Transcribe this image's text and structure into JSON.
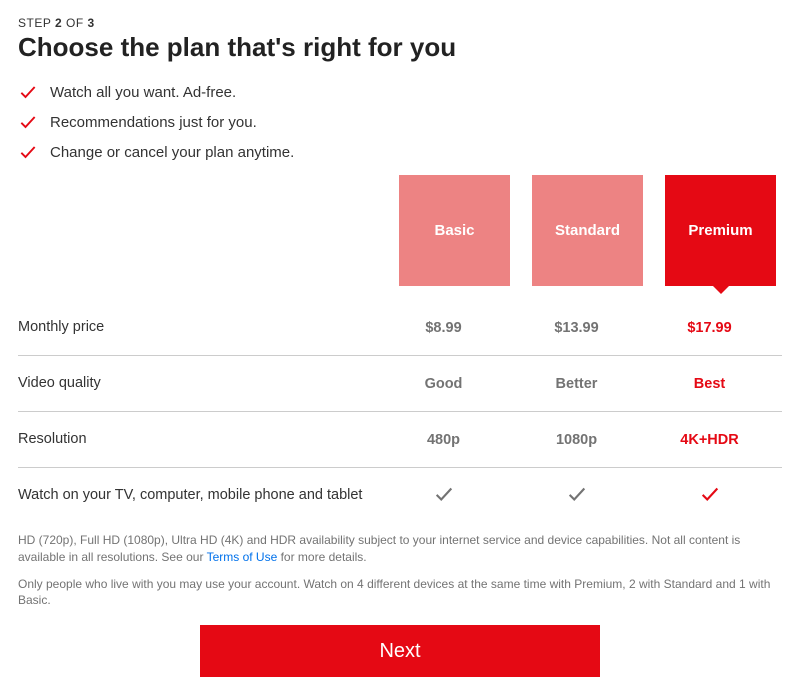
{
  "step": {
    "prefix": "STEP",
    "current": "2",
    "of_word": "OF",
    "total": "3"
  },
  "title": "Choose the plan that's right for you",
  "benefits": [
    "Watch all you want. Ad-free.",
    "Recommendations just for you.",
    "Change or cancel your plan anytime."
  ],
  "plans": {
    "selected_index": 2,
    "names": [
      "Basic",
      "Standard",
      "Premium"
    ]
  },
  "features": [
    {
      "label": "Monthly price",
      "values": [
        "$8.99",
        "$13.99",
        "$17.99"
      ],
      "type": "text"
    },
    {
      "label": "Video quality",
      "values": [
        "Good",
        "Better",
        "Best"
      ],
      "type": "text"
    },
    {
      "label": "Resolution",
      "values": [
        "480p",
        "1080p",
        "4K+HDR"
      ],
      "type": "text"
    },
    {
      "label": "Watch on your TV, computer, mobile phone and tablet",
      "values": [
        "✓",
        "✓",
        "✓"
      ],
      "type": "check"
    }
  ],
  "disclaimers": {
    "d1_a": "HD (720p), Full HD (1080p), Ultra HD (4K) and HDR availability subject to your internet service and device capabilities. Not all content is available in all resolutions. See our ",
    "d1_link": "Terms of Use",
    "d1_b": " for more details.",
    "d2": "Only people who live with you may use your account. Watch on 4 different devices at the same time with Premium, 2 with Standard and 1 with Basic."
  },
  "next_button": "Next",
  "colors": {
    "accent": "#e50914",
    "faded_accent": "#ed8383",
    "link": "#0071eb"
  }
}
